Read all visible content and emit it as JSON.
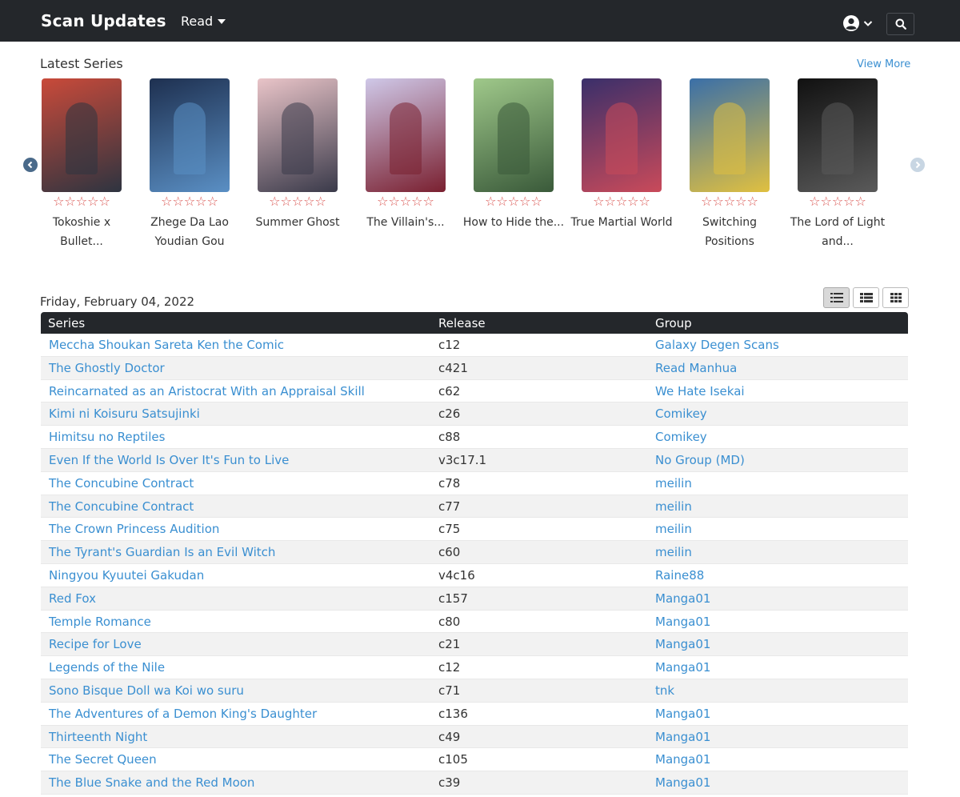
{
  "navbar": {
    "brand": "Scan Updates",
    "read_label": "Read",
    "user_icon": "user-circle-icon",
    "search_icon": "search-icon"
  },
  "latest": {
    "title": "Latest Series",
    "view_more": "View More",
    "cards": [
      {
        "title": "Tokoshie x Bullet...",
        "cover_color": "#c94a3a",
        "cover_accent": "#2e3440",
        "rating": "☆☆☆☆☆"
      },
      {
        "title": "Zhege Da Lao Youdian Gou",
        "cover_color": "#1e3050",
        "cover_accent": "#5a8fc4",
        "rating": "☆☆☆☆☆"
      },
      {
        "title": "Summer Ghost",
        "cover_color": "#e9c4c8",
        "cover_accent": "#3a3a4a",
        "rating": "☆☆☆☆☆"
      },
      {
        "title": "The Villain's...",
        "cover_color": "#cfc8e8",
        "cover_accent": "#7a2030",
        "rating": "☆☆☆☆☆"
      },
      {
        "title": "How to Hide the...",
        "cover_color": "#9fc88a",
        "cover_accent": "#3a5a3a",
        "rating": "☆☆☆☆☆"
      },
      {
        "title": "True Martial World",
        "cover_color": "#3a2f6a",
        "cover_accent": "#c94a5a",
        "rating": "☆☆☆☆☆"
      },
      {
        "title": "Switching Positions",
        "cover_color": "#3a6fa8",
        "cover_accent": "#e0c040",
        "rating": "☆☆☆☆☆"
      },
      {
        "title": "The Lord of Light and...",
        "cover_color": "#111111",
        "cover_accent": "#5a5a5a",
        "rating": "☆☆☆☆☆"
      }
    ]
  },
  "updates": {
    "date": "Friday, February 04, 2022",
    "headers": {
      "series": "Series",
      "release": "Release",
      "group": "Group"
    },
    "rows": [
      {
        "series": "Meccha Shoukan Sareta Ken the Comic",
        "release": "c12",
        "group": "Galaxy Degen Scans"
      },
      {
        "series": "The Ghostly Doctor",
        "release": "c421",
        "group": "Read Manhua"
      },
      {
        "series": "Reincarnated as an Aristocrat With an Appraisal Skill",
        "release": "c62",
        "group": "We Hate Isekai"
      },
      {
        "series": "Kimi ni Koisuru Satsujinki",
        "release": "c26",
        "group": "Comikey"
      },
      {
        "series": "Himitsu no Reptiles",
        "release": "c88",
        "group": "Comikey"
      },
      {
        "series": "Even If the World Is Over It's Fun to Live",
        "release": "v3c17.1",
        "group": "No Group (MD)"
      },
      {
        "series": "The Concubine Contract",
        "release": "c78",
        "group": "meilin"
      },
      {
        "series": "The Concubine Contract",
        "release": "c77",
        "group": "meilin"
      },
      {
        "series": "The Crown Princess Audition",
        "release": "c75",
        "group": "meilin"
      },
      {
        "series": "The Tyrant's Guardian Is an Evil Witch",
        "release": "c60",
        "group": "meilin"
      },
      {
        "series": "Ningyou Kyuutei Gakudan",
        "release": "v4c16",
        "group": "Raine88"
      },
      {
        "series": "Red Fox",
        "release": "c157",
        "group": "Manga01"
      },
      {
        "series": "Temple Romance",
        "release": "c80",
        "group": "Manga01"
      },
      {
        "series": "Recipe for Love",
        "release": "c21",
        "group": "Manga01"
      },
      {
        "series": "Legends of the Nile",
        "release": "c12",
        "group": "Manga01"
      },
      {
        "series": "Sono Bisque Doll wa Koi wo suru",
        "release": "c71",
        "group": "tnk"
      },
      {
        "series": "The Adventures of a Demon King's Daughter",
        "release": "c136",
        "group": "Manga01"
      },
      {
        "series": "Thirteenth Night",
        "release": "c49",
        "group": "Manga01"
      },
      {
        "series": "The Secret Queen",
        "release": "c105",
        "group": "Manga01"
      },
      {
        "series": "The Blue Snake and the Red Moon",
        "release": "c39",
        "group": "Manga01"
      }
    ]
  },
  "colors": {
    "navbar_bg": "#24272b",
    "link": "#3a8fd1",
    "star": "#d9534f"
  }
}
